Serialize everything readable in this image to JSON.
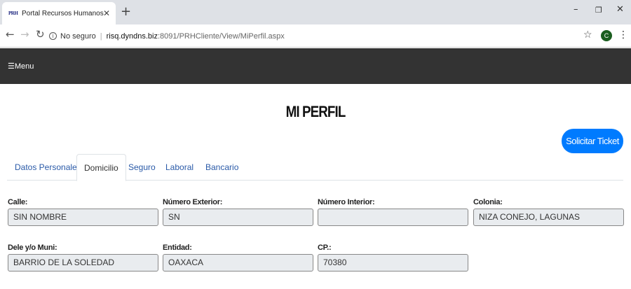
{
  "browser": {
    "tab_title": "Portal Recursos Humanos",
    "favicon_text": "PRH",
    "security_label": "No seguro",
    "url_host": "risq.dyndns.biz",
    "url_path": ":8091/PRHCliente/View/MiPerfil.aspx",
    "profile_initial": "C"
  },
  "navbar": {
    "menu_label": "☰Menu"
  },
  "page": {
    "title": "MI PERFIL",
    "ticket_button": "Solicitar Ticket"
  },
  "tabs": [
    {
      "label": "Datos Personales"
    },
    {
      "label": "Domicilio"
    },
    {
      "label": "Seguro"
    },
    {
      "label": "Laboral"
    },
    {
      "label": "Bancario"
    }
  ],
  "active_tab": "Domicilio",
  "fields": {
    "calle": {
      "label": "Calle:",
      "value": "SIN NOMBRE"
    },
    "numero_exterior": {
      "label": "Número Exterior:",
      "value": "SN"
    },
    "numero_interior": {
      "label": "Número Interior:",
      "value": ""
    },
    "colonia": {
      "label": "Colonia:",
      "value": "NIZA CONEJO, LAGUNAS"
    },
    "municipio": {
      "label": "Dele y/o Muni:",
      "value": "BARRIO DE LA SOLEDAD"
    },
    "entidad": {
      "label": "Entidad:",
      "value": "OAXACA"
    },
    "cp": {
      "label": "CP.:",
      "value": "70380"
    }
  },
  "colors": {
    "navbar_bg": "#333333",
    "primary_button": "#007bff",
    "tab_link": "#2a5aa8"
  }
}
